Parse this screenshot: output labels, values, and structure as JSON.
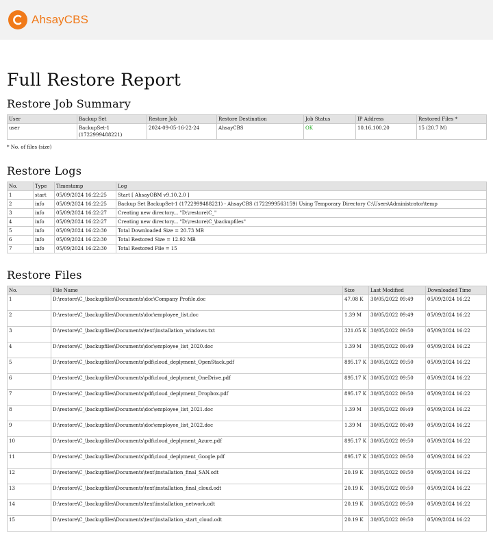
{
  "header": {
    "logo_text": "AhsayCBS",
    "brand_color": "#f07a1a"
  },
  "report_title": "Full Restore Report",
  "summary": {
    "title": "Restore Job Summary",
    "columns": [
      "User",
      "Backup Set",
      "Restore Job",
      "Restore Destination",
      "Job Status",
      "IP Address",
      "Restored Files *"
    ],
    "row": {
      "user": "user",
      "backup_set": "BackupSet-1 (1722999488221)",
      "restore_job": "2024-09-05-16-22-24",
      "destination": "AhsayCBS",
      "status": "OK",
      "ip": "10.16.100.20",
      "restored_files": "15 (20.7 M)"
    },
    "status_color": "#1aa51a",
    "note": "* No. of files (size)"
  },
  "logs": {
    "title": "Restore Logs",
    "columns": [
      "No.",
      "Type",
      "Timestamp",
      "Log"
    ],
    "rows": [
      {
        "no": "1",
        "type": "start",
        "timestamp": "05/09/2024 16:22:25",
        "log": "Start [ AhsayOBM v9.10.2.0 ]"
      },
      {
        "no": "2",
        "type": "info",
        "timestamp": "05/09/2024 16:22:25",
        "log": "Backup Set BackupSet-1 (1722999488221) - AhsayCBS (1722999563159) Using Temporary Directory C:\\Users\\Administrator\\temp"
      },
      {
        "no": "3",
        "type": "info",
        "timestamp": "05/09/2024 16:22:27",
        "log": "Creating new directory... \"D:\\restore\\C_\""
      },
      {
        "no": "4",
        "type": "info",
        "timestamp": "05/09/2024 16:22:27",
        "log": "Creating new directory... \"D:\\restore\\C_\\backupfiles\""
      },
      {
        "no": "5",
        "type": "info",
        "timestamp": "05/09/2024 16:22:30",
        "log": "Total Downloaded Size = 20.73 MB"
      },
      {
        "no": "6",
        "type": "info",
        "timestamp": "05/09/2024 16:22:30",
        "log": "Total Restored Size = 12.92 MB"
      },
      {
        "no": "7",
        "type": "info",
        "timestamp": "05/09/2024 16:22:30",
        "log": "Total Restored File = 15"
      }
    ]
  },
  "files": {
    "title": "Restore Files",
    "columns": [
      "No.",
      "File Name",
      "Size",
      "Last Modified",
      "Downloaded Time"
    ],
    "rows": [
      {
        "no": "1",
        "name": "D:\\restore\\C_\\backupfiles\\Documents\\doc\\Company Profile.doc",
        "size": "47.08 K",
        "modified": "30/05/2022 09:49",
        "downloaded": "05/09/2024 16:22"
      },
      {
        "no": "2",
        "name": "D:\\restore\\C_\\backupfiles\\Documents\\doc\\employee_list.doc",
        "size": "1.39 M",
        "modified": "30/05/2022 09:49",
        "downloaded": "05/09/2024 16:22"
      },
      {
        "no": "3",
        "name": "D:\\restore\\C_\\backupfiles\\Documents\\text\\installation_windows.txt",
        "size": "321.05 K",
        "modified": "30/05/2022 09:50",
        "downloaded": "05/09/2024 16:22"
      },
      {
        "no": "4",
        "name": "D:\\restore\\C_\\backupfiles\\Documents\\doc\\employee_list_2020.doc",
        "size": "1.39 M",
        "modified": "30/05/2022 09:49",
        "downloaded": "05/09/2024 16:22"
      },
      {
        "no": "5",
        "name": "D:\\restore\\C_\\backupfiles\\Documents\\pdf\\cloud_deplyment_OpenStack.pdf",
        "size": "895.17 K",
        "modified": "30/05/2022 09:50",
        "downloaded": "05/09/2024 16:22"
      },
      {
        "no": "6",
        "name": "D:\\restore\\C_\\backupfiles\\Documents\\pdf\\cloud_deplyment_OneDrive.pdf",
        "size": "895.17 K",
        "modified": "30/05/2022 09:50",
        "downloaded": "05/09/2024 16:22"
      },
      {
        "no": "7",
        "name": "D:\\restore\\C_\\backupfiles\\Documents\\pdf\\cloud_deplyment_Dropbox.pdf",
        "size": "895.17 K",
        "modified": "30/05/2022 09:50",
        "downloaded": "05/09/2024 16:22"
      },
      {
        "no": "8",
        "name": "D:\\restore\\C_\\backupfiles\\Documents\\doc\\employee_list_2021.doc",
        "size": "1.39 M",
        "modified": "30/05/2022 09:49",
        "downloaded": "05/09/2024 16:22"
      },
      {
        "no": "9",
        "name": "D:\\restore\\C_\\backupfiles\\Documents\\doc\\employee_list_2022.doc",
        "size": "1.39 M",
        "modified": "30/05/2022 09:49",
        "downloaded": "05/09/2024 16:22"
      },
      {
        "no": "10",
        "name": "D:\\restore\\C_\\backupfiles\\Documents\\pdf\\cloud_deplyment_Azure.pdf",
        "size": "895.17 K",
        "modified": "30/05/2022 09:50",
        "downloaded": "05/09/2024 16:22"
      },
      {
        "no": "11",
        "name": "D:\\restore\\C_\\backupfiles\\Documents\\pdf\\cloud_deplyment_Google.pdf",
        "size": "895.17 K",
        "modified": "30/05/2022 09:50",
        "downloaded": "05/09/2024 16:22"
      },
      {
        "no": "12",
        "name": "D:\\restore\\C_\\backupfiles\\Documents\\text\\installation_final_SAN.odt",
        "size": "20.19 K",
        "modified": "30/05/2022 09:50",
        "downloaded": "05/09/2024 16:22"
      },
      {
        "no": "13",
        "name": "D:\\restore\\C_\\backupfiles\\Documents\\text\\installation_final_cloud.odt",
        "size": "20.19 K",
        "modified": "30/05/2022 09:50",
        "downloaded": "05/09/2024 16:22"
      },
      {
        "no": "14",
        "name": "D:\\restore\\C_\\backupfiles\\Documents\\text\\installation_network.odt",
        "size": "20.19 K",
        "modified": "30/05/2022 09:50",
        "downloaded": "05/09/2024 16:22"
      },
      {
        "no": "15",
        "name": "D:\\restore\\C_\\backupfiles\\Documents\\text\\installation_start_cloud.odt",
        "size": "20.19 K",
        "modified": "30/05/2022 09:50",
        "downloaded": "05/09/2024 16:22"
      }
    ]
  }
}
